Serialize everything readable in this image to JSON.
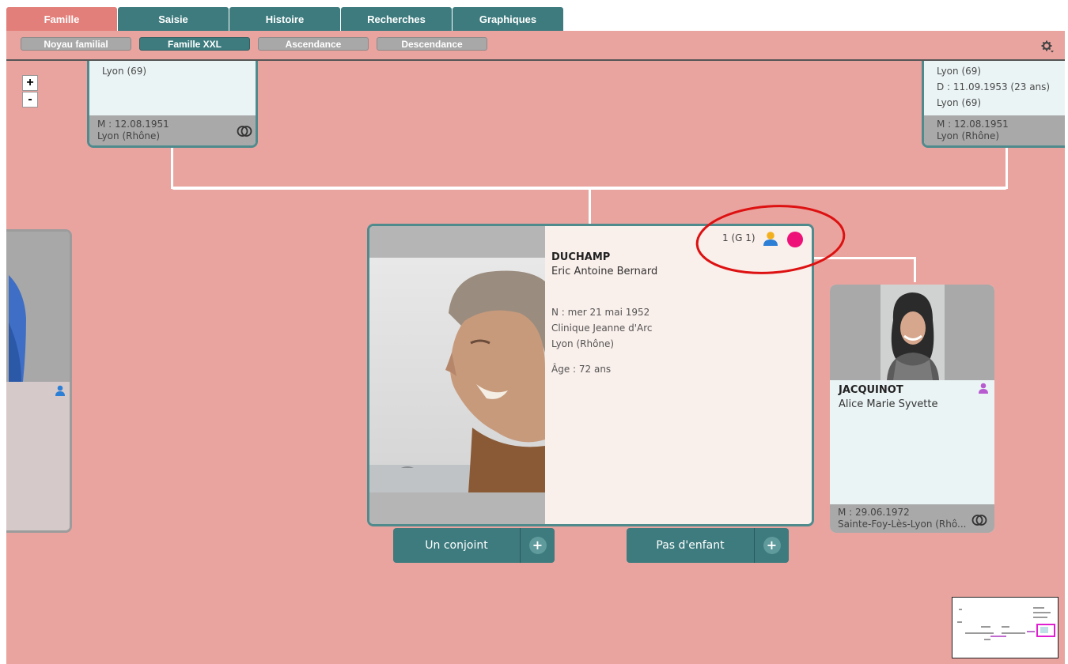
{
  "tabs": [
    {
      "label": "Famille",
      "active": true
    },
    {
      "label": "Saisie",
      "active": false
    },
    {
      "label": "Histoire",
      "active": false
    },
    {
      "label": "Recherches",
      "active": false
    },
    {
      "label": "Graphiques",
      "active": false
    }
  ],
  "subtabs": [
    {
      "label": "Noyau familial",
      "active": false
    },
    {
      "label": "Famille XXL",
      "active": true
    },
    {
      "label": "Ascendance",
      "active": false
    },
    {
      "label": "Descendance",
      "active": false
    }
  ],
  "zoom": {
    "in": "+",
    "out": "-"
  },
  "father_card": {
    "place": "Lyon (69)",
    "marriage_date": "M : 12.08.1951",
    "marriage_place": "Lyon (Rhône)"
  },
  "mother_card": {
    "place": "Lyon (69)",
    "death": "D : 11.09.1953 (23 ans)",
    "death_place": "Lyon (69)",
    "marriage_date": "M : 12.08.1951",
    "marriage_place": "Lyon (Rhône)"
  },
  "main_person": {
    "badge": "1 (G 1)",
    "surname": "DUCHAMP",
    "given": "Eric Antoine Bernard",
    "birth": "N : mer 21 mai 1952",
    "birth_place1": "Clinique Jeanne d'Arc",
    "birth_place2": "Lyon (Rhône)",
    "age": "Âge : 72 ans"
  },
  "spouse_card": {
    "surname": "JACQUINOT",
    "given": "Alice Marie Syvette",
    "marriage_date": "M : 29.06.1972",
    "marriage_place": "Sainte-Foy-Lès-Lyon (Rhô..."
  },
  "actions": {
    "spouse": "Un conjoint",
    "children": "Pas d'enfant"
  },
  "colors": {
    "accent": "#3d7b7e",
    "active_tab": "#e37f7a",
    "background": "#eaa49f",
    "male_icon": "#2d7fd6",
    "female_icon": "#b85ad0",
    "status_dot": "#ee1177",
    "annotation": "#dd1111"
  },
  "icons": [
    "gear-icon",
    "ring-icon",
    "male-person-icon",
    "female-person-icon",
    "plus-icon"
  ]
}
